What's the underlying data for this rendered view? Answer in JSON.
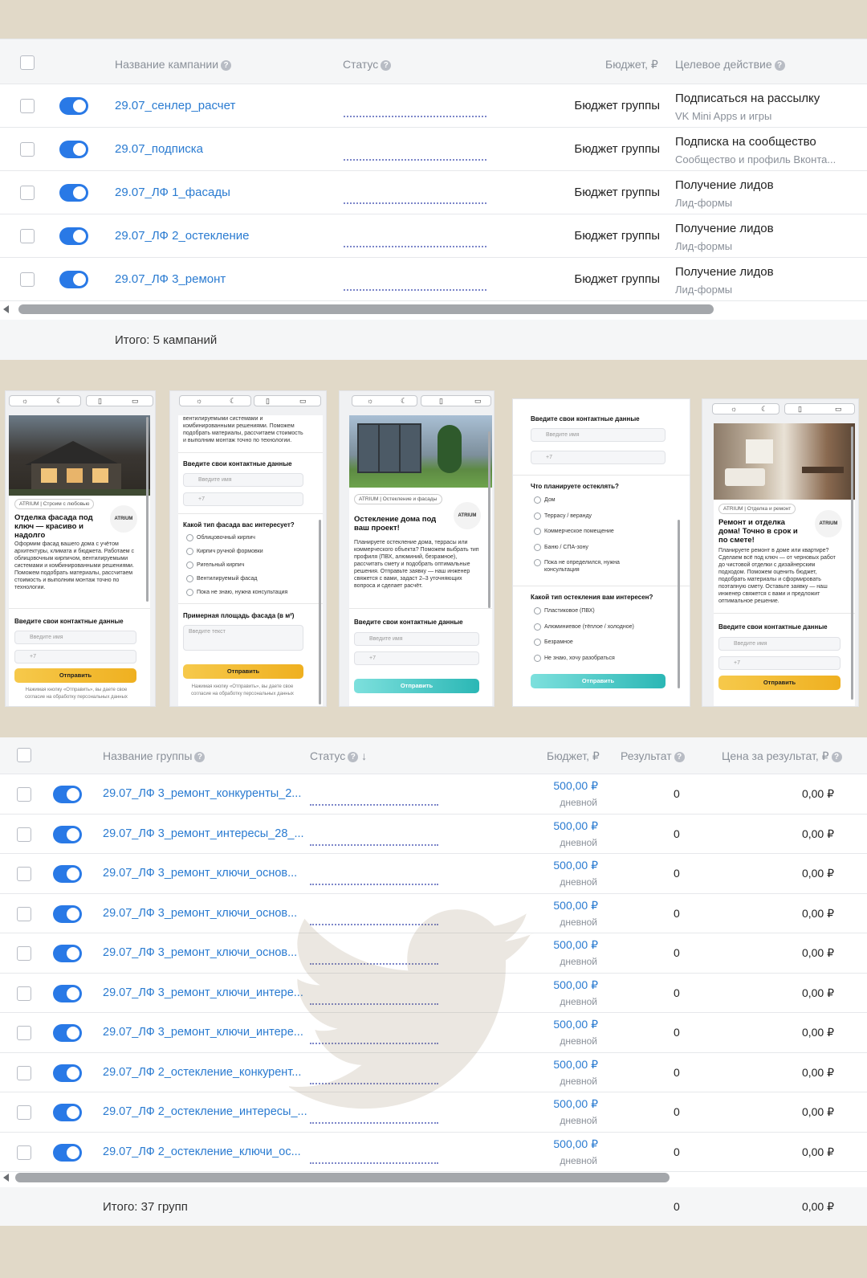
{
  "campaigns": {
    "headers": {
      "name": "Название кампании",
      "status": "Статус",
      "budget": "Бюджет, ₽",
      "target": "Целевое действие"
    },
    "rows": [
      {
        "name": "29.07_сенлер_расчет",
        "budget": "Бюджет группы",
        "target": "Подписаться на рассылку",
        "target_sub": "VK Mini Apps и игры"
      },
      {
        "name": "29.07_подписка",
        "budget": "Бюджет группы",
        "target": "Подписка на сообщество",
        "target_sub": "Сообщество и профиль Вконта..."
      },
      {
        "name": "29.07_ЛФ 1_фасады",
        "budget": "Бюджет группы",
        "target": "Получение лидов",
        "target_sub": "Лид-формы"
      },
      {
        "name": "29.07_ЛФ 2_остекление",
        "budget": "Бюджет группы",
        "target": "Получение лидов",
        "target_sub": "Лид-формы"
      },
      {
        "name": "29.07_ЛФ 3_ремонт",
        "budget": "Бюджет группы",
        "target": "Получение лидов",
        "target_sub": "Лид-формы"
      }
    ],
    "total": "Итого: 5 кампаний"
  },
  "previews": {
    "icons": {
      "light": "sun-icon",
      "dark": "moon-icon",
      "mobile": "phone-icon",
      "desktop": "monitor-icon"
    },
    "glyphs": {
      "sun": "☼",
      "moon": "☾",
      "phone": "▯",
      "desktop": "▭"
    },
    "c1": {
      "badge": "ATRIUM | Строим с любовью",
      "logo": "ATRIUM",
      "title": "Отделка фасада под ключ — красиво и надолго",
      "text": "Оформим фасад вашего дома с учётом архитектуры, климата и бюджета. Работаем с облицовочным кирпичом, вентилируемыми системами и комбинированными решениями. Поможем подобрать материалы, рассчитаем стоимость и выполним монтаж точно по технологии.",
      "contacts": "Введите свои контактные данные",
      "name_ph": "Введите имя",
      "phone_ph": "+7",
      "send": "Отправить",
      "legal": "Нажимая кнопку «Отправить», вы даете свое согласие на обработку персональных данных"
    },
    "c2": {
      "text": "вентилируемыми системами и комбинированными решениями. Поможем подобрать материалы, рассчитаем стоимость и выполним монтаж точно по технологии.",
      "contacts": "Введите свои контактные данные",
      "name_ph": "Введите имя",
      "phone_ph": "+7",
      "question": "Какой тип фасада вас интересует?",
      "options": [
        "Облицовочный кирпич",
        "Кирпич ручной формовки",
        "Ригельный кирпич",
        "Вентилируемый фасад",
        "Пока не знаю, нужна консультация"
      ],
      "area": "Примерная площадь фасада (в м²)",
      "area_ph": "Введите текст",
      "send": "Отправить",
      "legal": "Нажимая кнопку «Отправить», вы даете свое согласие на обработку персональных данных"
    },
    "c3": {
      "badge": "ATRIUM | Остекление и фасады",
      "logo": "ATRIUM",
      "title": "Остекление дома под ваш проект!",
      "text": "Планируете остекление дома, террасы или коммерческого объекта? Поможем выбрать тип профиля (ПВХ, алюминий, безрамное), рассчитать смету и подобрать оптимальные решения. Отправьте заявку — наш инженер свяжется с вами, задаст 2–3 уточняющих вопроса и сделает расчёт.",
      "contacts": "Введите свои контактные данные",
      "name_ph": "Введите имя",
      "phone_ph": "+7",
      "send": "Отправить"
    },
    "c4": {
      "contacts": "Введите свои контактные данные",
      "name_ph": "Введите имя",
      "phone_ph": "+7",
      "q1": "Что планируете остеклять?",
      "q1_options": [
        "Дом",
        "Террасу / веранду",
        "Коммерческое помещение",
        "Баню / СПА-зону",
        "Пока не определился, нужна консультация"
      ],
      "q2": "Какой тип остекления вам интересен?",
      "q2_options": [
        "Пластиковое (ПВХ)",
        "Алюминиевое (тёплое / холодное)",
        "Безрамное",
        "Не знаю, хочу разобраться"
      ],
      "send": "Отправить"
    },
    "c5": {
      "badge": "ATRIUM | Отделка и ремонт",
      "logo": "ATRIUM",
      "title": "Ремонт и отделка дома! Точно в срок и по смете!",
      "text": "Планируете ремонт в доме или квартире? Сделаем всё под ключ — от черновых работ до чистовой отделки с дизайнерским подходом. Поможем оценить бюджет, подобрать материалы и сформировать поэтапную смету. Оставьте заявку — наш инженер свяжется с вами и предложит оптимальное решение.",
      "contacts": "Введите свои контактные данные",
      "name_ph": "Введите имя",
      "phone_ph": "+7",
      "send": "Отправить"
    }
  },
  "groups": {
    "headers": {
      "name": "Название группы",
      "status": "Статус",
      "sort": "↓",
      "budget": "Бюджет, ₽",
      "result": "Результат",
      "cpr": "Цена за результат, ₽"
    },
    "rows": [
      {
        "name": "29.07_ЛФ 3_ремонт_конкуренты_2...",
        "budget": "500,00 ₽",
        "period": "дневной",
        "result": "0",
        "cpr": "0,00 ₽"
      },
      {
        "name": "29.07_ЛФ 3_ремонт_интересы_28_...",
        "budget": "500,00 ₽",
        "period": "дневной",
        "result": "0",
        "cpr": "0,00 ₽"
      },
      {
        "name": "29.07_ЛФ 3_ремонт_ключи_основ...",
        "budget": "500,00 ₽",
        "period": "дневной",
        "result": "0",
        "cpr": "0,00 ₽"
      },
      {
        "name": "29.07_ЛФ 3_ремонт_ключи_основ...",
        "budget": "500,00 ₽",
        "period": "дневной",
        "result": "0",
        "cpr": "0,00 ₽"
      },
      {
        "name": "29.07_ЛФ 3_ремонт_ключи_основ...",
        "budget": "500,00 ₽",
        "period": "дневной",
        "result": "0",
        "cpr": "0,00 ₽"
      },
      {
        "name": "29.07_ЛФ 3_ремонт_ключи_интере...",
        "budget": "500,00 ₽",
        "period": "дневной",
        "result": "0",
        "cpr": "0,00 ₽"
      },
      {
        "name": "29.07_ЛФ 3_ремонт_ключи_интере...",
        "budget": "500,00 ₽",
        "period": "дневной",
        "result": "0",
        "cpr": "0,00 ₽"
      },
      {
        "name": "29.07_ЛФ 2_остекление_конкурент...",
        "budget": "500,00 ₽",
        "period": "дневной",
        "result": "0",
        "cpr": "0,00 ₽"
      },
      {
        "name": "29.07_ЛФ 2_остекление_интересы_...",
        "budget": "500,00 ₽",
        "period": "дневной",
        "result": "0",
        "cpr": "0,00 ₽"
      },
      {
        "name": "29.07_ЛФ 2_остекление_ключи_ос...",
        "budget": "500,00 ₽",
        "period": "дневной",
        "result": "0",
        "cpr": "0,00 ₽"
      }
    ],
    "total": "Итого: 37 групп",
    "total_result": "0",
    "total_cpr": "0,00 ₽"
  },
  "watermark": "bird-icon",
  "colors": {
    "link": "#2a7bd1",
    "toggle": "#2979e6",
    "background": "#e1d9c8"
  }
}
